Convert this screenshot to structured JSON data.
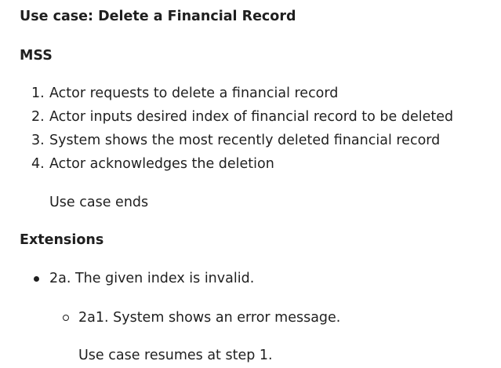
{
  "title": "Use case: Delete a Financial Record",
  "mss": {
    "heading": "MSS",
    "steps": [
      {
        "num": "1.",
        "text": "Actor requests to delete a financial record"
      },
      {
        "num": "2.",
        "text": "Actor inputs desired index of financial record to be deleted"
      },
      {
        "num": "3.",
        "text": "System shows the most recently deleted financial record"
      },
      {
        "num": "4.",
        "text": "Actor acknowledges the deletion"
      }
    ],
    "end_text": "Use case ends"
  },
  "extensions": {
    "heading": "Extensions",
    "items": [
      {
        "text": "2a. The given index is invalid.",
        "sub_items": [
          {
            "text": "2a1. System shows an error message.",
            "note": "Use case resumes at step 1."
          }
        ]
      }
    ]
  }
}
